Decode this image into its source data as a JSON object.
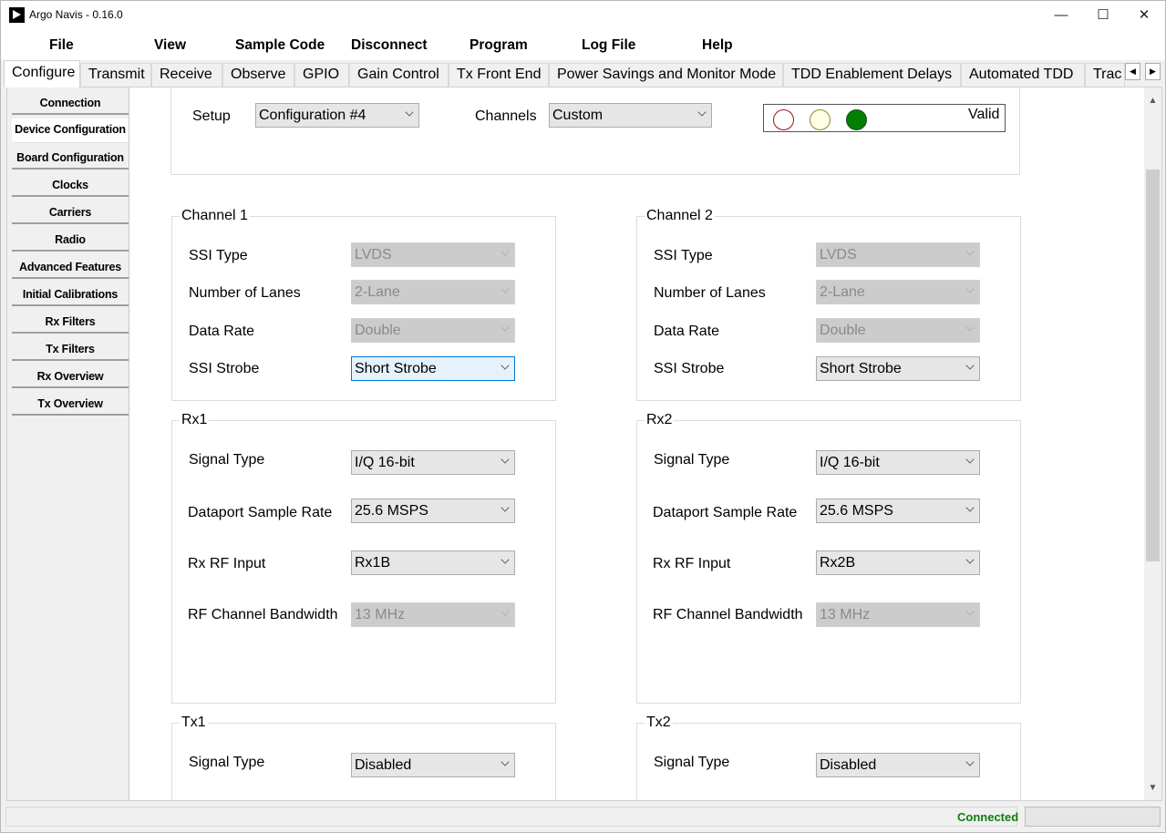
{
  "window": {
    "title": "Argo Navis - 0.16.0",
    "minimize": "—",
    "maximize": "☐",
    "close": "✕"
  },
  "menu": [
    "File",
    "View",
    "Sample Code",
    "Disconnect",
    "Program",
    "Log File",
    "Help"
  ],
  "tabs": [
    "Configure",
    "Transmit",
    "Receive",
    "Observe",
    "GPIO",
    "Gain Control",
    "Tx Front End",
    "Power Savings and Monitor Mode",
    "TDD Enablement Delays",
    "Automated TDD",
    "Trac"
  ],
  "active_tab": "Configure",
  "sidebar": [
    "Connection",
    "Device Configuration",
    "Board Configuration",
    "Clocks",
    "Carriers",
    "Radio",
    "Advanced Features",
    "Initial Calibrations",
    "Rx Filters",
    "Tx Filters",
    "Rx Overview",
    "Tx Overview"
  ],
  "active_sidebar": "Device Configuration",
  "setup": {
    "setup_label": "Setup",
    "setup_value": "Configuration #4",
    "channels_label": "Channels",
    "channels_value": "Custom",
    "status_text": "Valid",
    "leds": {
      "red": "#ffffff",
      "yellow": "#ffffff",
      "green": "#008000"
    }
  },
  "channel1": {
    "title": "Channel 1",
    "ssi_type": {
      "label": "SSI Type",
      "value": "LVDS"
    },
    "lanes": {
      "label": "Number of Lanes",
      "value": "2-Lane"
    },
    "data_rate": {
      "label": "Data Rate",
      "value": "Double"
    },
    "ssi_strobe": {
      "label": "SSI Strobe",
      "value": "Short Strobe"
    }
  },
  "channel2": {
    "title": "Channel 2",
    "ssi_type": {
      "label": "SSI Type",
      "value": "LVDS"
    },
    "lanes": {
      "label": "Number of Lanes",
      "value": "2-Lane"
    },
    "data_rate": {
      "label": "Data Rate",
      "value": "Double"
    },
    "ssi_strobe": {
      "label": "SSI Strobe",
      "value": "Short Strobe"
    }
  },
  "rx1": {
    "title": "Rx1",
    "signal_type": {
      "label": "Signal Type",
      "value": "I/Q 16-bit"
    },
    "sample_rate": {
      "label": "Dataport Sample Rate",
      "value": "25.6 MSPS"
    },
    "rf_input": {
      "label": "Rx RF Input",
      "value": "Rx1B"
    },
    "bandwidth": {
      "label": "RF Channel Bandwidth",
      "value": "13 MHz"
    }
  },
  "rx2": {
    "title": "Rx2",
    "signal_type": {
      "label": "Signal Type",
      "value": "I/Q 16-bit"
    },
    "sample_rate": {
      "label": "Dataport Sample Rate",
      "value": "25.6 MSPS"
    },
    "rf_input": {
      "label": "Rx RF Input",
      "value": "Rx2B"
    },
    "bandwidth": {
      "label": "RF Channel Bandwidth",
      "value": "13 MHz"
    }
  },
  "tx1": {
    "title": "Tx1",
    "signal_type": {
      "label": "Signal Type",
      "value": "Disabled"
    }
  },
  "tx2": {
    "title": "Tx2",
    "signal_type": {
      "label": "Signal Type",
      "value": "Disabled"
    }
  },
  "statusbar": {
    "connection": "Connected"
  }
}
